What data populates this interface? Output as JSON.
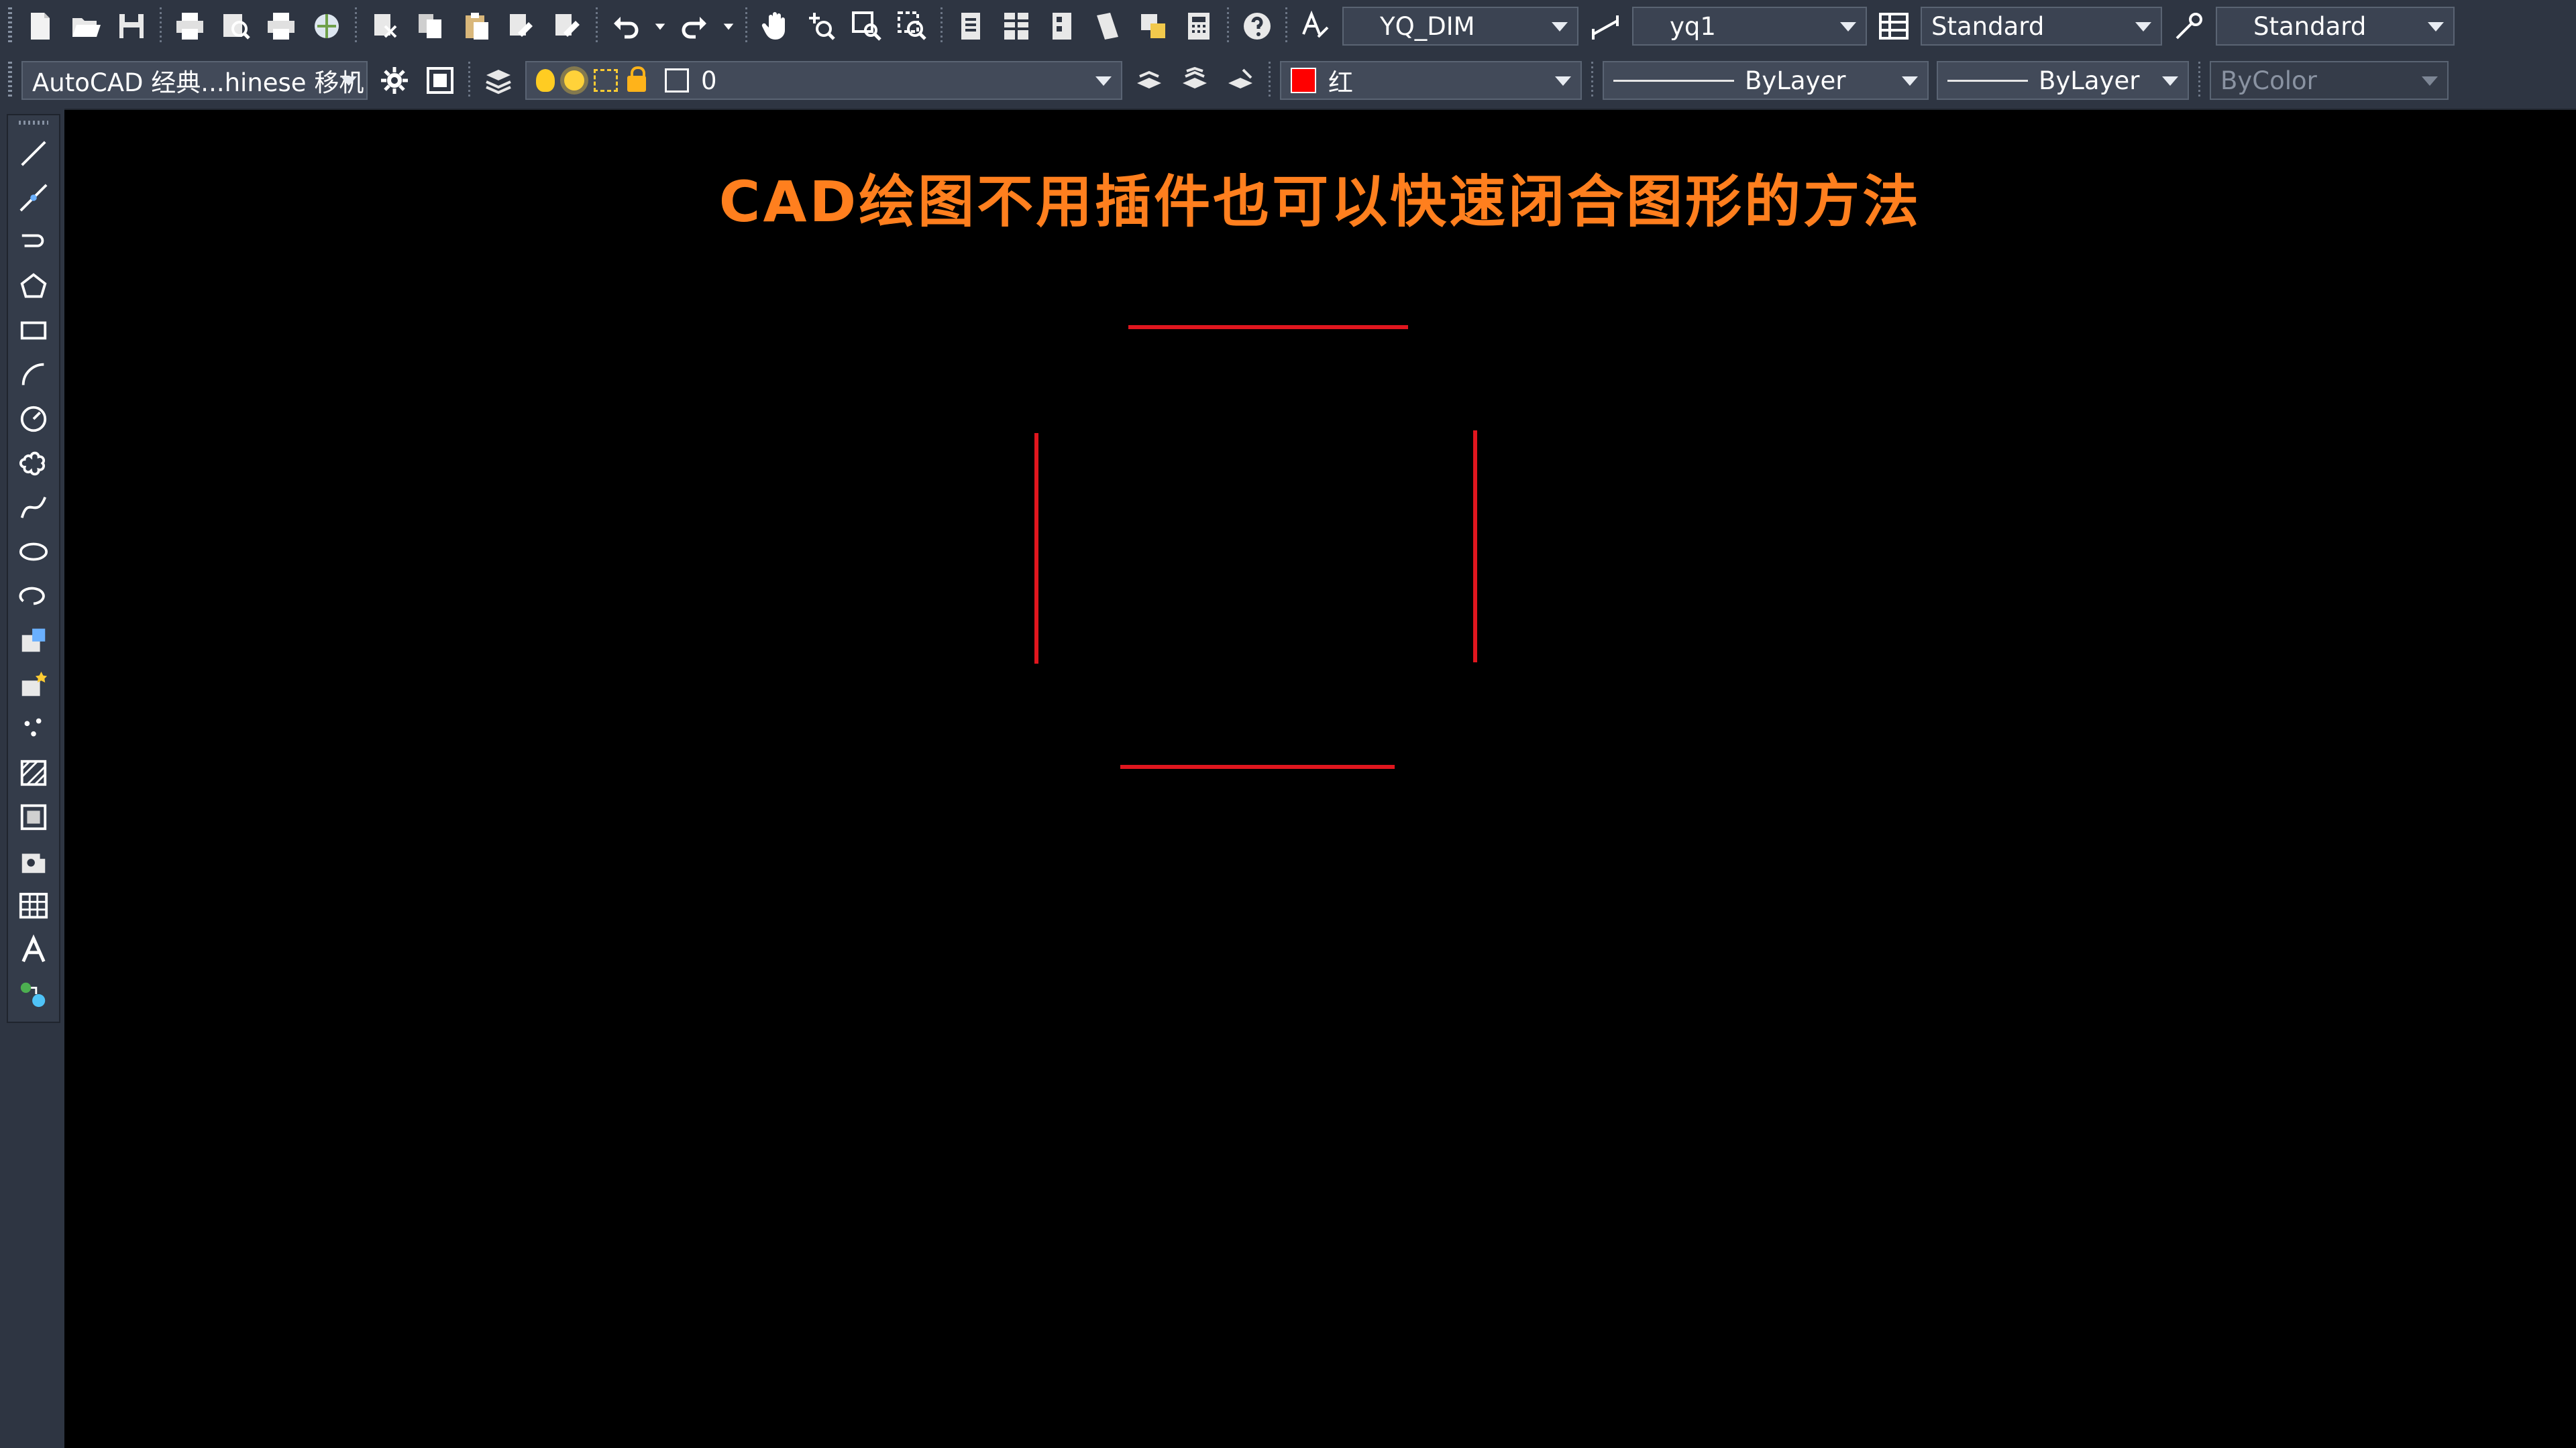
{
  "toolbar_top": {
    "dim_style": "YQ_DIM",
    "text_style": "yq1",
    "table_style": "Standard",
    "multileader_style": "Standard"
  },
  "toolbar_second": {
    "workspace": "AutoCAD 经典...hinese 移机",
    "layer": "0",
    "color": "红",
    "linetype": "ByLayer",
    "lineweight": "ByLayer",
    "plot_style": "ByColor"
  },
  "canvas": {
    "title": "CAD绘图不用插件也可以快速闭合图形的方法",
    "line_color": "#e0161e",
    "title_color": "#ff7f1e"
  },
  "icons": {
    "top": [
      "new-icon",
      "open-icon",
      "save-icon",
      "plot-icon",
      "plot-preview-icon",
      "publish-icon",
      "3d-dwf-icon",
      "cut-icon",
      "copy-icon",
      "paste-icon",
      "match-properties-icon",
      "block-editor-icon",
      "undo-icon",
      "redo-icon",
      "pan-icon",
      "zoom-realtime-icon",
      "zoom-window-icon",
      "zoom-previous-icon",
      "properties-icon",
      "design-center-icon",
      "tool-palettes-icon",
      "sheet-set-icon",
      "markup-icon",
      "quickcalc-icon",
      "help-icon",
      "text-style-icon",
      "dim-style-icon",
      "table-style-icon",
      "multileader-style-icon"
    ],
    "left": [
      "line-icon",
      "construction-line-icon",
      "polyline-icon",
      "polygon-icon",
      "rectangle-icon",
      "arc-icon",
      "circle-icon",
      "revision-cloud-icon",
      "spline-icon",
      "ellipse-icon",
      "ellipse-arc-icon",
      "insert-block-icon",
      "make-block-icon",
      "point-icon",
      "hatch-icon",
      "gradient-icon",
      "region-icon",
      "table-icon",
      "mtext-icon",
      "add-selected-icon"
    ]
  }
}
